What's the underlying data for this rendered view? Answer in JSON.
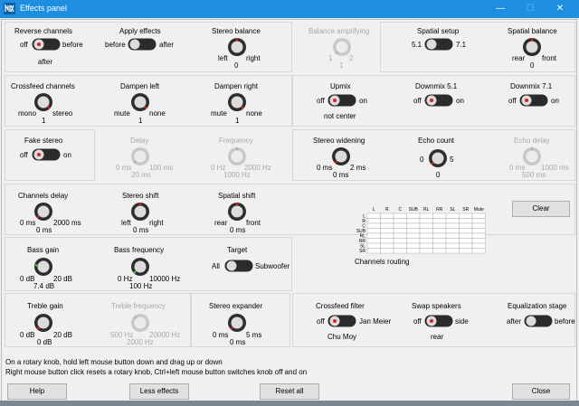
{
  "window": {
    "title": "Effects panel",
    "controls": {
      "minimize": "—",
      "maximize": "☐",
      "close": "✕"
    },
    "titlebar_color": "#1e8fe0"
  },
  "row1": {
    "reverse_channels": {
      "title": "Reverse channels",
      "left": "off",
      "right": "before",
      "below": "after"
    },
    "apply_effects": {
      "title": "Apply effects",
      "left": "before",
      "right": "after"
    },
    "stereo_balance": {
      "title": "Stereo balance",
      "left": "left",
      "right": "right",
      "value": "0"
    },
    "balance_amplifying": {
      "title": "Balance amplifying",
      "left": "1",
      "right": "2",
      "value": "1"
    },
    "spatial_setup": {
      "title": "Spatial setup",
      "left": "5.1",
      "right": "7.1"
    },
    "spatial_balance": {
      "title": "Spatial balance",
      "left": "rear",
      "right": "front",
      "value": "0"
    }
  },
  "row2": {
    "crossfeed_channels": {
      "title": "Crossfeed channels",
      "left": "mono",
      "right": "stereo",
      "value": "1"
    },
    "dampen_left": {
      "title": "Dampen left",
      "left": "mute",
      "right": "none",
      "value": "1"
    },
    "dampen_right": {
      "title": "Dampen right",
      "left": "mute",
      "right": "none",
      "value": "1"
    },
    "upmix": {
      "title": "Upmix",
      "left": "off",
      "right": "on",
      "below": "not center"
    },
    "downmix51": {
      "title": "Downmix 5.1",
      "left": "off",
      "right": "on"
    },
    "downmix71": {
      "title": "Downmix 7.1",
      "left": "off",
      "right": "on"
    }
  },
  "row3": {
    "fake_stereo": {
      "title": "Fake stereo",
      "left": "off",
      "right": "on"
    },
    "delay": {
      "title": "Delay",
      "left": "0 ms",
      "right": "100 ms",
      "value": "20 ms"
    },
    "frequency": {
      "title": "Frequency",
      "left": "0 Hz",
      "right": "2000 Hz",
      "value": "1000 Hz"
    },
    "stereo_widening": {
      "title": "Stereo widening",
      "left": "0 ms",
      "right": "2 ms",
      "value": "0 ms"
    },
    "echo_count": {
      "title": "Echo count",
      "left": "0",
      "right": "5",
      "value": "0"
    },
    "echo_delay": {
      "title": "Echo delay",
      "left": "0 ms",
      "right": "1000 ms",
      "value": "500 ms"
    }
  },
  "row4": {
    "channels_delay": {
      "title": "Channels delay",
      "left": "0 ms",
      "right": "2000 ms",
      "value": "0 ms"
    },
    "stereo_shift": {
      "title": "Stereo shift",
      "left": "left",
      "right": "right",
      "value": "0 ms"
    },
    "spatial_shift": {
      "title": "Spatial shift",
      "left": "rear",
      "right": "front",
      "value": "0 ms"
    },
    "clear_label": "Clear",
    "routing": {
      "columns": [
        "L",
        "R",
        "C",
        "SUB",
        "RL",
        "RR",
        "SL",
        "SR",
        "Mute"
      ],
      "rows": [
        "L",
        "R",
        "C",
        "SUB",
        "RL",
        "RR",
        "SL",
        "SR"
      ],
      "label": "Channels routing"
    }
  },
  "row5": {
    "bass_gain": {
      "title": "Bass gain",
      "left": "0 dB",
      "right": "20 dB",
      "value": "7.4 dB"
    },
    "bass_frequency": {
      "title": "Bass frequency",
      "left": "0 Hz",
      "right": "10000 Hz",
      "value": "100 Hz"
    },
    "target": {
      "title": "Target",
      "left": "All",
      "right": "Subwoofer"
    }
  },
  "row6": {
    "treble_gain": {
      "title": "Treble gain",
      "left": "0 dB",
      "right": "20 dB",
      "value": "0 dB"
    },
    "treble_frequency": {
      "title": "Treble frequency",
      "left": "500 Hz",
      "right": "20000 Hz",
      "value": "2000 Hz"
    },
    "stereo_expander": {
      "title": "Stereo expander",
      "left": "0 ms",
      "right": "5 ms",
      "value": "0 ms"
    },
    "crossfeed_filter": {
      "title": "Crossfeed filter",
      "left": "off",
      "right": "Jan Meier",
      "below": "Chu Moy"
    },
    "swap_speakers": {
      "title": "Swap speakers",
      "left": "off",
      "right": "side",
      "below": "rear"
    },
    "equalization_stage": {
      "title": "Equalization stage",
      "left": "after",
      "right": "before"
    }
  },
  "footer": {
    "help_line1": "On a rotary knob, hold left mouse button down and drag up or down",
    "help_line2": "Right mouse button click resets a rotary knob, Ctrl+left mouse button switches knob off and on",
    "buttons": {
      "help": "Help",
      "less_effects": "Less effects",
      "reset_all": "Reset all",
      "close": "Close"
    }
  },
  "colors": {
    "indicator_red": "#e02020",
    "indicator_green": "#3cd23c",
    "background": "#f0f0f0"
  }
}
